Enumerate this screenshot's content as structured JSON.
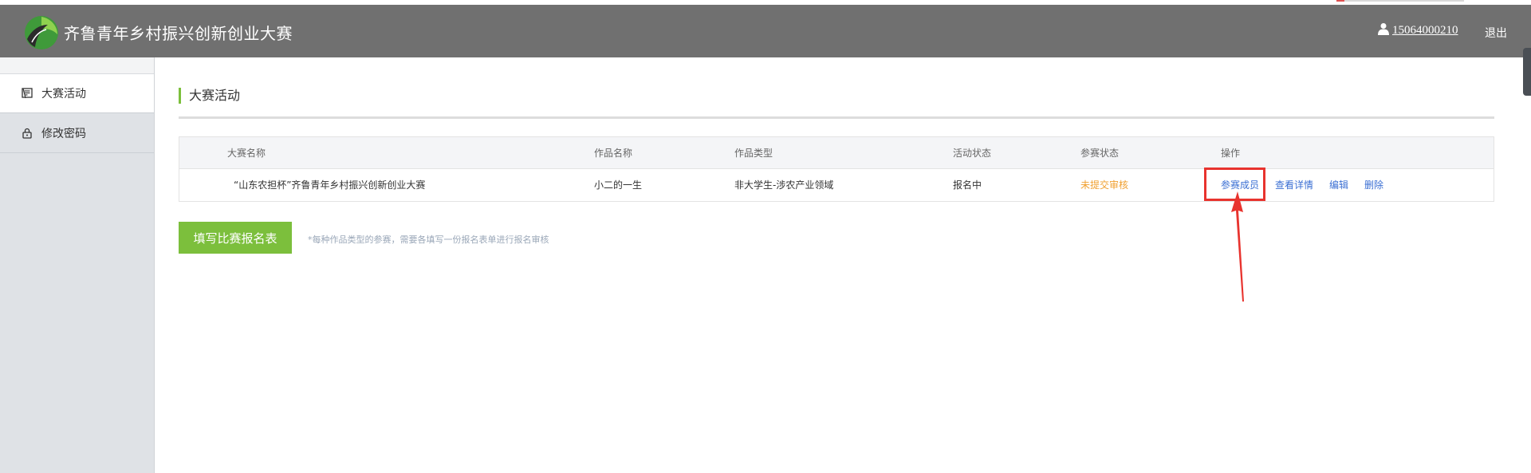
{
  "header": {
    "app_title": "齐鲁青年乡村振兴创新创业大赛",
    "user_phone": "15064000210",
    "logout_label": "退出"
  },
  "sidebar": {
    "items": [
      {
        "label": "大赛活动",
        "icon": "certificate-icon",
        "active": true
      },
      {
        "label": "修改密码",
        "icon": "lock-icon",
        "active": false
      }
    ]
  },
  "main": {
    "section_title": "大赛活动",
    "table": {
      "headers": [
        "大赛名称",
        "作品名称",
        "作品类型",
        "活动状态",
        "参赛状态",
        "操作"
      ],
      "rows": [
        {
          "contest_name": "“山东农担杯”齐鲁青年乡村振兴创新创业大赛",
          "work_name": "小二的一生",
          "work_type": "非大学生-涉农产业领域",
          "activity_status": "报名中",
          "entry_status": "未提交审核",
          "actions": [
            "参赛成员",
            "查看详情",
            "编辑",
            "删除"
          ]
        }
      ]
    },
    "primary_button_label": "填写比赛报名表",
    "hint_text": "*每种作品类型的参赛，需要各填写一份报名表单进行报名审核"
  },
  "colors": {
    "header_bg": "#707070",
    "accent_green": "#7cbf3c",
    "link_blue": "#3b6fd3",
    "pending_orange": "#f0a030",
    "annotation_red": "#e8332e"
  }
}
